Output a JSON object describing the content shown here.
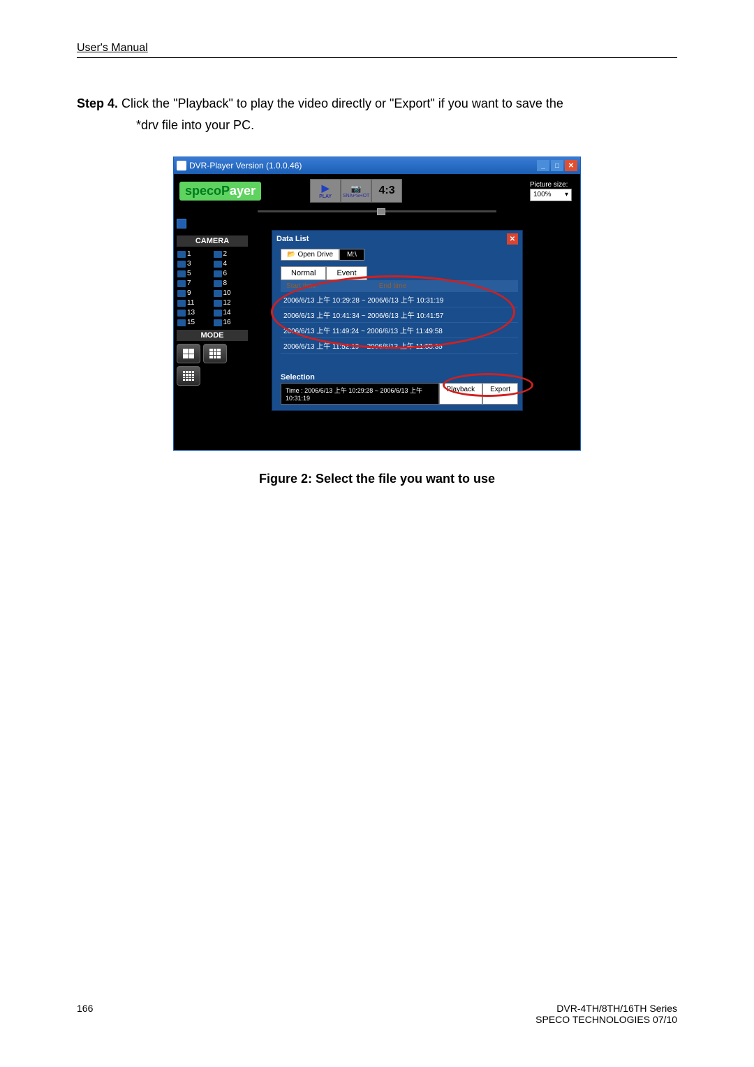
{
  "header": "User's Manual",
  "step": {
    "label": "Step 4.",
    "text_line1": "Click the \"Playback\" to play the video directly or \"Export\" if you want to save the",
    "text_line2": "*drv file into your PC."
  },
  "app": {
    "title": "DVR-Player Version (1.0.0.46)",
    "logo_prefix": "specoP",
    "logo_suffix": "ayer",
    "play_btn": "PLAY",
    "snapshot_btn": "SNAPSHOT",
    "aspect_btn": "4:3",
    "picture_size_label": "Picture size:",
    "picture_size_value": "100%",
    "camera_label": "CAMERA",
    "cameras": [
      "1",
      "2",
      "3",
      "4",
      "5",
      "6",
      "7",
      "8",
      "9",
      "10",
      "11",
      "12",
      "13",
      "14",
      "15",
      "16"
    ],
    "mode_label": "MODE",
    "data_list": {
      "title": "Data List",
      "open_drive": "Open Drive",
      "drive": "M:\\",
      "tab_normal": "Normal",
      "tab_event": "Event",
      "col1": "Start time",
      "col2": "End time",
      "entries": [
        "2006/6/13 上午 10:29:28 ~ 2006/6/13 上午 10:31:19",
        "2006/6/13 上午 10:41:34 ~ 2006/6/13 上午 10:41:57",
        "2006/6/13 上午 11:49:24 ~ 2006/6/13 上午 11:49:58",
        "2006/6/13 上午 11:52:19 ~ 2006/6/13 上午 11:55:35"
      ],
      "selection_label": "Selection",
      "selection_time": "Time : 2006/6/13 上午 10:29:28 ~ 2006/6/13 上午 10:31:19",
      "playback_btn": "Playback",
      "export_btn": "Export"
    }
  },
  "figure_caption": "Figure 2: Select the file you want to use",
  "footer": {
    "page": "166",
    "line1": "DVR-4TH/8TH/16TH Series",
    "line2": "SPECO TECHNOLOGIES 07/10"
  }
}
